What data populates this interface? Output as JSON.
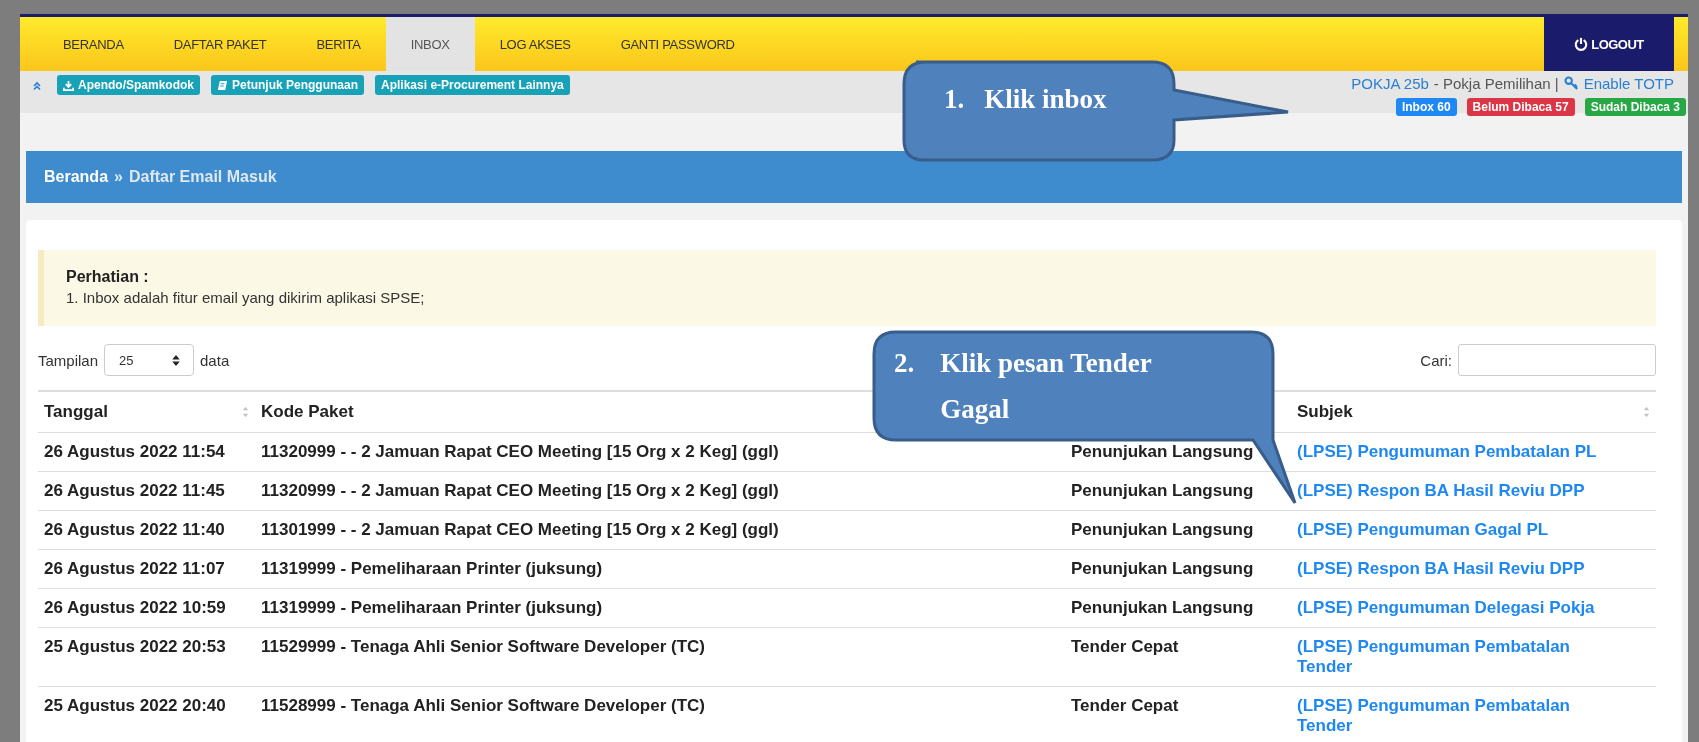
{
  "nav": {
    "items": [
      {
        "label": "BERANDA",
        "selected": false
      },
      {
        "label": "DAFTAR PAKET",
        "selected": false
      },
      {
        "label": "BERITA",
        "selected": false
      },
      {
        "label": "INBOX",
        "selected": true
      },
      {
        "label": "LOG AKSES",
        "selected": false
      },
      {
        "label": "GANTI PASSWORD",
        "selected": false
      }
    ],
    "logout": "LOGOUT"
  },
  "toolbar": {
    "buttons": [
      "Apendo/Spamkodok",
      "Petunjuk Penggunaan",
      "Aplikasi e-Procurement Lainnya"
    ],
    "user": "POKJA 25b",
    "role": "- Pokja Pemilihan |",
    "totp": "Enable TOTP"
  },
  "badges": [
    {
      "label": "Inbox 60",
      "color": "#1f88f5"
    },
    {
      "label": "Belum Dibaca 57",
      "color": "#dc3545"
    },
    {
      "label": "Sudah Dibaca 3",
      "color": "#28a745"
    }
  ],
  "breadcrumb": {
    "home": "Beranda",
    "separator": "»",
    "current": "Daftar Email Masuk"
  },
  "notice": {
    "title": "Perhatian :",
    "text": "1. Inbox adalah fitur email yang dikirim aplikasi SPSE;"
  },
  "length": {
    "label": "Tampilan",
    "value": "25",
    "suffix": "data"
  },
  "search": {
    "label": "Cari:"
  },
  "table": {
    "columns": [
      {
        "label": "Tanggal",
        "sortable": true
      },
      {
        "label": "Kode Paket"
      },
      {},
      {
        "label": "Subjek",
        "sortable": true
      }
    ],
    "rows": [
      {
        "tanggal": "26 Agustus 2022 11:54",
        "kode_paket": "11320999 - - 2 Jamuan Rapat CEO Meeting [15 Org x 2 Keg] (ggl)",
        "column_3": "Penunjukan Langsung",
        "subjek": "(LPSE) Pengumuman Pembatalan PL"
      },
      {
        "tanggal": "26 Agustus 2022 11:45",
        "kode_paket": "11320999 - - 2 Jamuan Rapat CEO Meeting [15 Org x 2 Keg] (ggl)",
        "column_3": "Penunjukan Langsung",
        "subjek": "(LPSE) Respon BA Hasil Reviu DPP"
      },
      {
        "tanggal": "26 Agustus 2022 11:40",
        "kode_paket": "11301999 - - 2 Jamuan Rapat CEO Meeting [15 Org x 2 Keg] (ggl)",
        "column_3": "Penunjukan Langsung",
        "subjek": "(LPSE) Pengumuman Gagal PL"
      },
      {
        "tanggal": "26 Agustus 2022 11:07",
        "kode_paket": "11319999 - Pemeliharaan Printer (juksung)",
        "column_3": "Penunjukan Langsung",
        "subjek": "(LPSE) Respon BA Hasil Reviu DPP"
      },
      {
        "tanggal": "26 Agustus 2022 10:59",
        "kode_paket": "11319999 - Pemeliharaan Printer (juksung)",
        "column_3": "Penunjukan Langsung",
        "subjek": "(LPSE) Pengumuman Delegasi Pokja"
      },
      {
        "tanggal": "25 Agustus 2022 20:53",
        "kode_paket": "11529999 - Tenaga Ahli Senior Software Developer (TC)",
        "column_3": "Tender Cepat",
        "subjek": "(LPSE) Pengumuman Pembatalan Tender"
      },
      {
        "tanggal": "25 Agustus 2022 20:40",
        "kode_paket": "11528999 - Tenaga Ahli Senior Software Developer (TC)",
        "column_3": "Tender Cepat",
        "subjek": "(LPSE) Pengumuman Pembatalan Tender"
      }
    ]
  },
  "callouts": [
    {
      "number": "1.",
      "text": "Klik inbox"
    },
    {
      "number": "2.",
      "text": "Klik pesan Tender Gagal"
    }
  ]
}
